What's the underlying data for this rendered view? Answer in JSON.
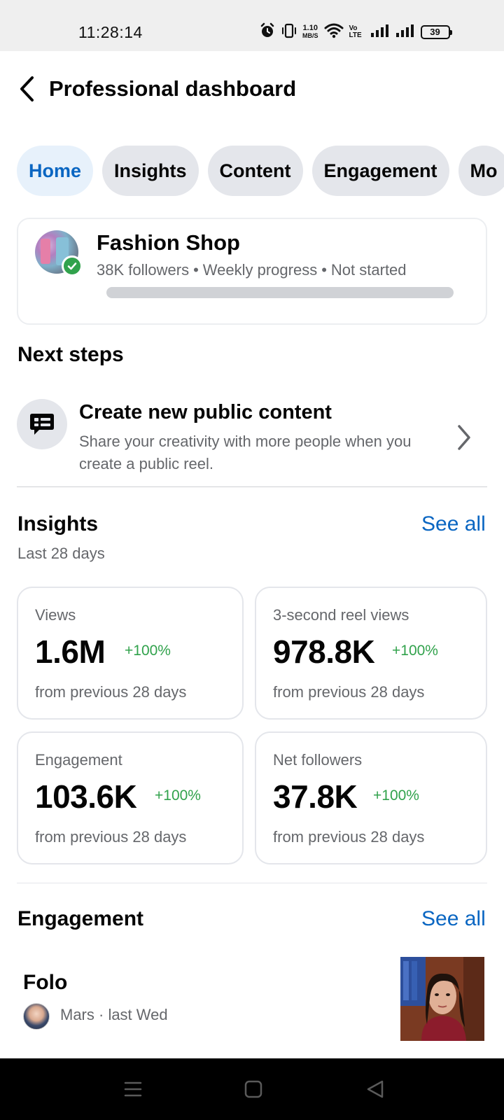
{
  "status_bar": {
    "time": "11:28:14",
    "speed_value": "1.10",
    "speed_unit": "MB/S",
    "volte": "Vo LTE",
    "battery": "39"
  },
  "header": {
    "title": "Professional dashboard"
  },
  "tabs": [
    {
      "label": "Home",
      "active": true
    },
    {
      "label": "Insights",
      "active": false
    },
    {
      "label": "Content",
      "active": false
    },
    {
      "label": "Engagement",
      "active": false
    },
    {
      "label": "Mo",
      "active": false
    }
  ],
  "profile": {
    "name": "Fashion Shop",
    "followers": "38K followers",
    "weekly_progress": "Weekly progress",
    "status": "Not started",
    "separator": "•",
    "progress_fraction": 0
  },
  "next_steps": {
    "title": "Next steps",
    "item": {
      "title": "Create new public content",
      "description": "Share your creativity with more people when you create a public reel."
    }
  },
  "insights": {
    "title": "Insights",
    "see_all": "See all",
    "period": "Last 28 days",
    "metrics": [
      {
        "label": "Views",
        "value": "1.6M",
        "change": "+100%",
        "foot": "from previous 28 days"
      },
      {
        "label": "3-second reel views",
        "value": "978.8K",
        "change": "+100%",
        "foot": "from previous 28 days"
      },
      {
        "label": "Engagement",
        "value": "103.6K",
        "change": "+100%",
        "foot": "from previous 28 days"
      },
      {
        "label": "Net followers",
        "value": "37.8K",
        "change": "+100%",
        "foot": "from previous 28 days"
      }
    ]
  },
  "engagement": {
    "title": "Engagement",
    "see_all": "See all",
    "post": {
      "title": "Folo",
      "meta": "Mars · last Wed"
    }
  },
  "colors": {
    "accent": "#0a66c2",
    "positive": "#31a24c",
    "secondary_text": "#65676b"
  }
}
